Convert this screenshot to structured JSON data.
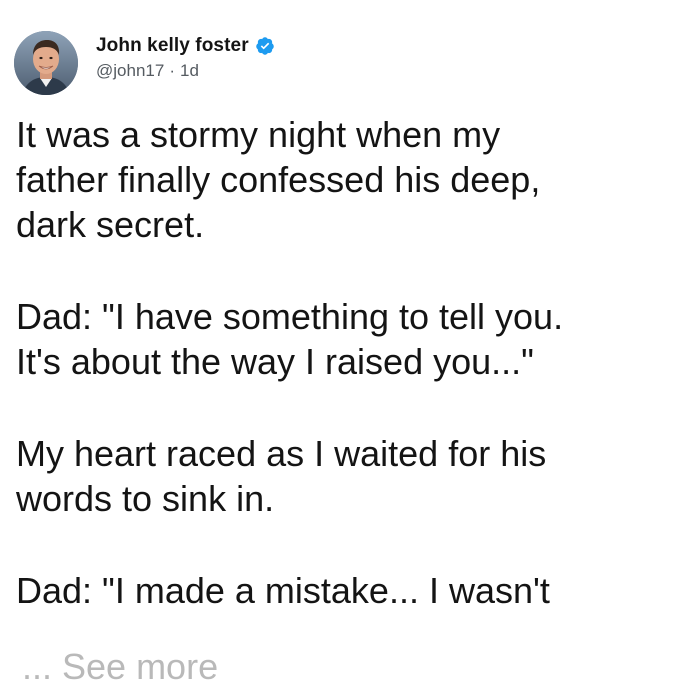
{
  "author": {
    "display_name": "John kelly foster",
    "handle": "@john17",
    "separator": "·",
    "time": "1d",
    "verified_icon": "verified-badge-icon",
    "avatar_icon": "profile-photo"
  },
  "tweet": {
    "paragraphs": [
      [
        "It was a stormy night when my",
        "father finally confessed his deep,",
        "dark secret."
      ],
      [
        "Dad: \"I have something to tell you.",
        "It's about the way I raised you...\""
      ],
      [
        "My heart raced as I waited for his",
        "words to sink in."
      ],
      [
        "Dad: \"I made a mistake... I wasn't"
      ]
    ],
    "see_more": "... See more"
  },
  "colors": {
    "verified_blue": "#1d9bf0",
    "text": "#141414",
    "muted": "#555b61",
    "see_more": "#b9b9b9"
  }
}
